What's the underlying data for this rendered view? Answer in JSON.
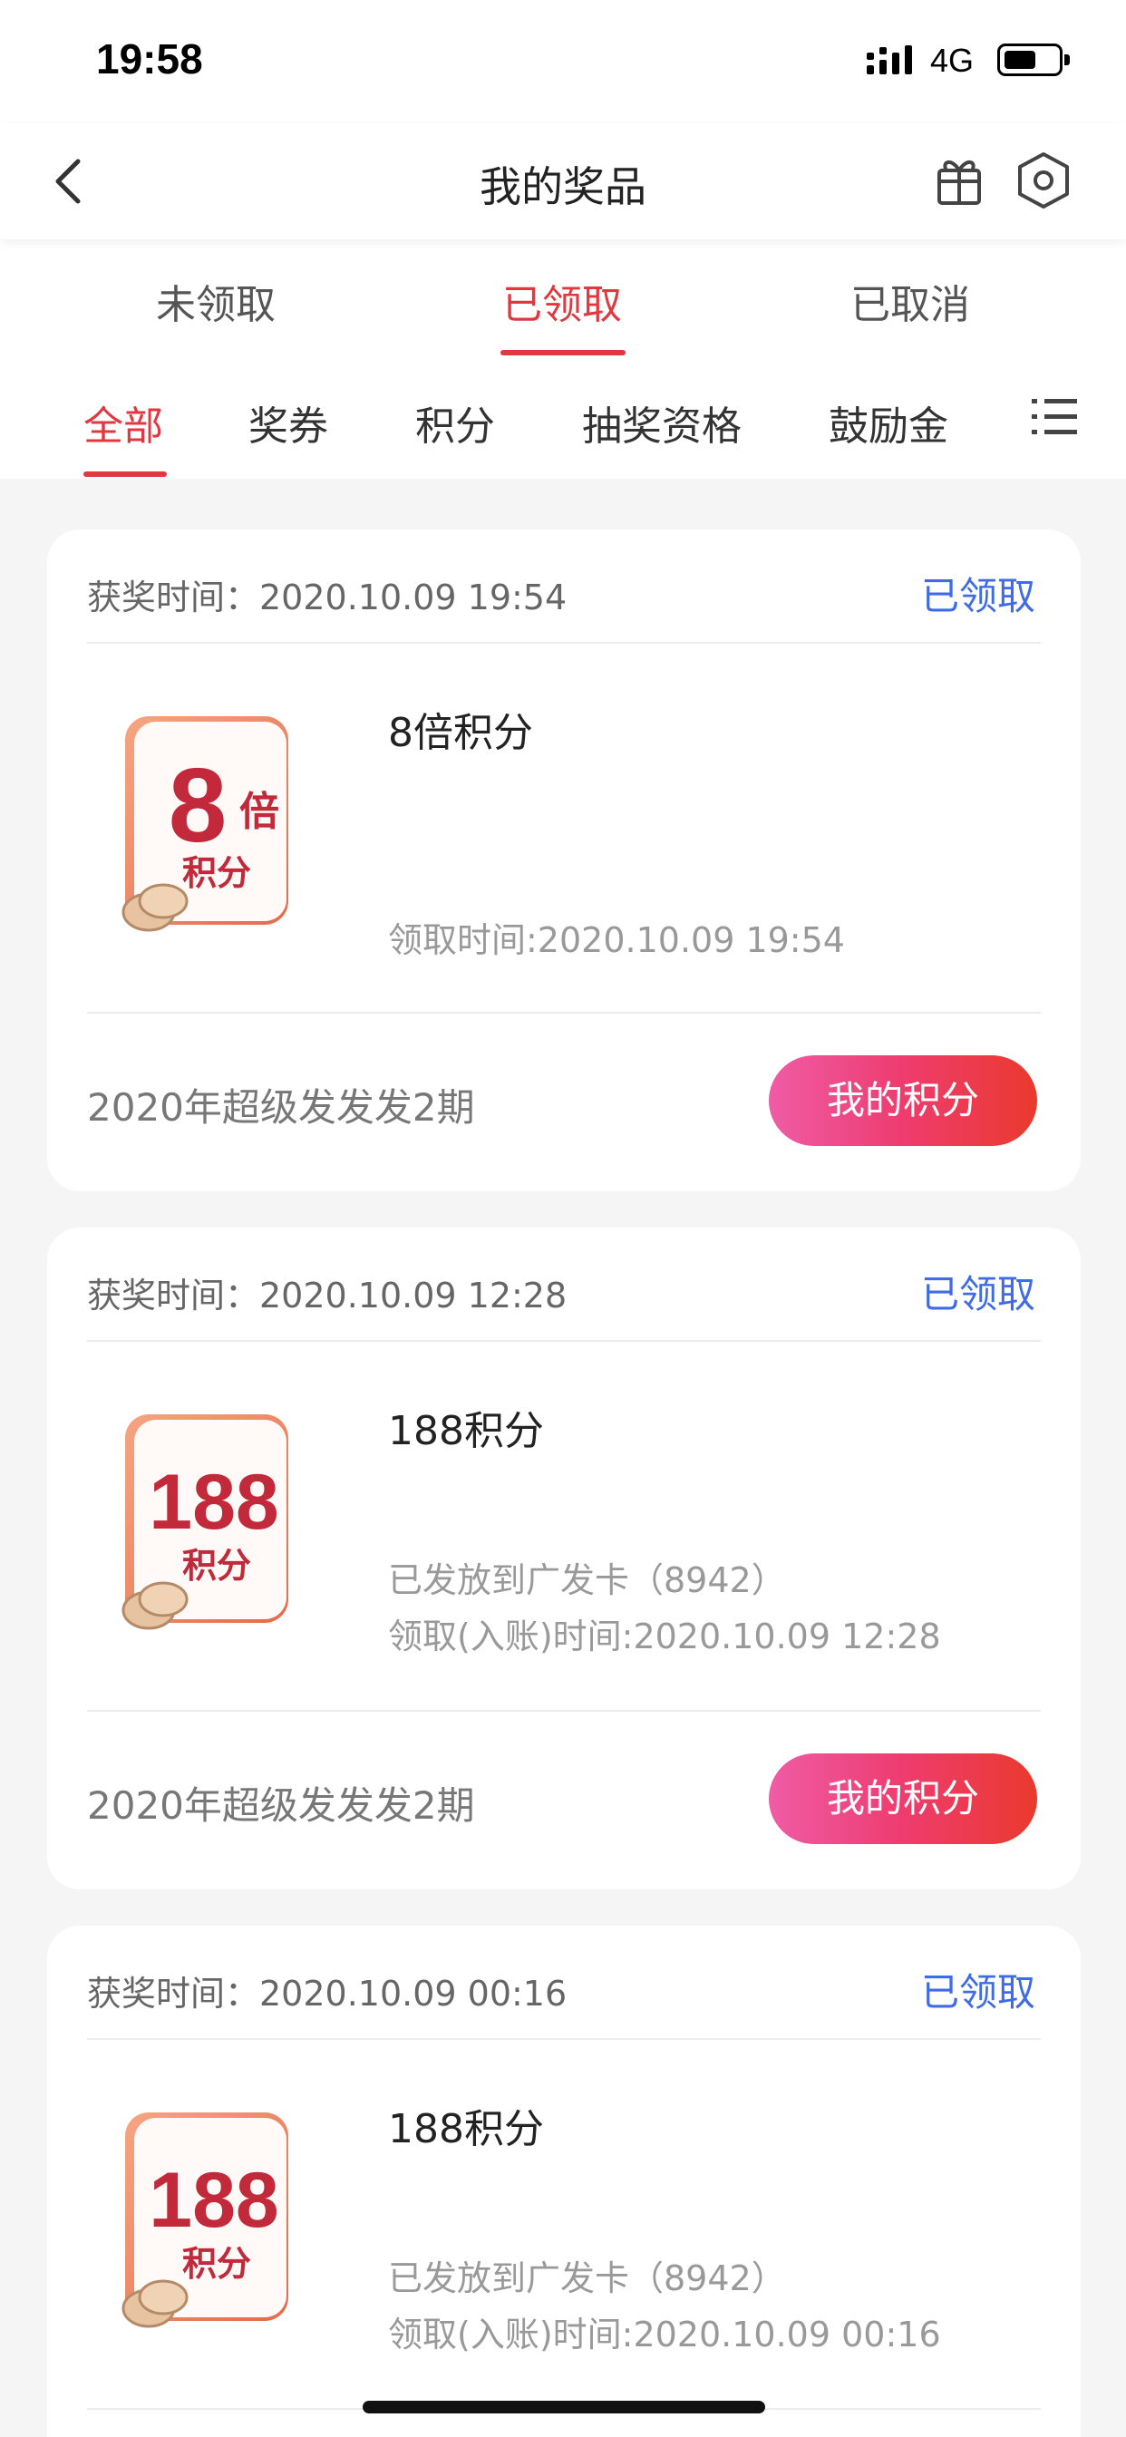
{
  "status_bar": {
    "time": "19:58",
    "network": "4G"
  },
  "nav": {
    "title": "我的奖品"
  },
  "status_tabs": [
    {
      "label": "未领取",
      "active": false
    },
    {
      "label": "已领取",
      "active": true
    },
    {
      "label": "已取消",
      "active": false
    }
  ],
  "category_tabs": [
    {
      "label": "全部",
      "active": true
    },
    {
      "label": "奖券",
      "active": false
    },
    {
      "label": "积分",
      "active": false
    },
    {
      "label": "抽奖资格",
      "active": false
    },
    {
      "label": "鼓励金",
      "active": false
    }
  ],
  "prizes": [
    {
      "win_time": "获奖时间：2020.10.09 19:54",
      "status": "已领取",
      "badge_big": "8",
      "badge_small": "倍",
      "badge_unit": "积分",
      "name": "8倍积分",
      "lines": [
        "领取时间:2020.10.09 19:54"
      ],
      "campaign": "2020年超级发发发2期",
      "button": "我的积分"
    },
    {
      "win_time": "获奖时间：2020.10.09 12:28",
      "status": "已领取",
      "badge_big": "188",
      "badge_small": "",
      "badge_unit": "积分",
      "name": "188积分",
      "lines": [
        "已发放到广发卡（8942）",
        "领取(入账)时间:2020.10.09 12:28"
      ],
      "campaign": "2020年超级发发发2期",
      "button": "我的积分"
    },
    {
      "win_time": "获奖时间：2020.10.09 00:16",
      "status": "已领取",
      "badge_big": "188",
      "badge_small": "",
      "badge_unit": "积分",
      "name": "188积分",
      "lines": [
        "已发放到广发卡（8942）",
        "领取(入账)时间:2020.10.09 00:16"
      ],
      "campaign": "",
      "button": ""
    }
  ],
  "colors": {
    "accent": "#e0383e",
    "link": "#3f6ce6",
    "button_start": "#ef5ca5",
    "button_end": "#ea3a2c"
  }
}
